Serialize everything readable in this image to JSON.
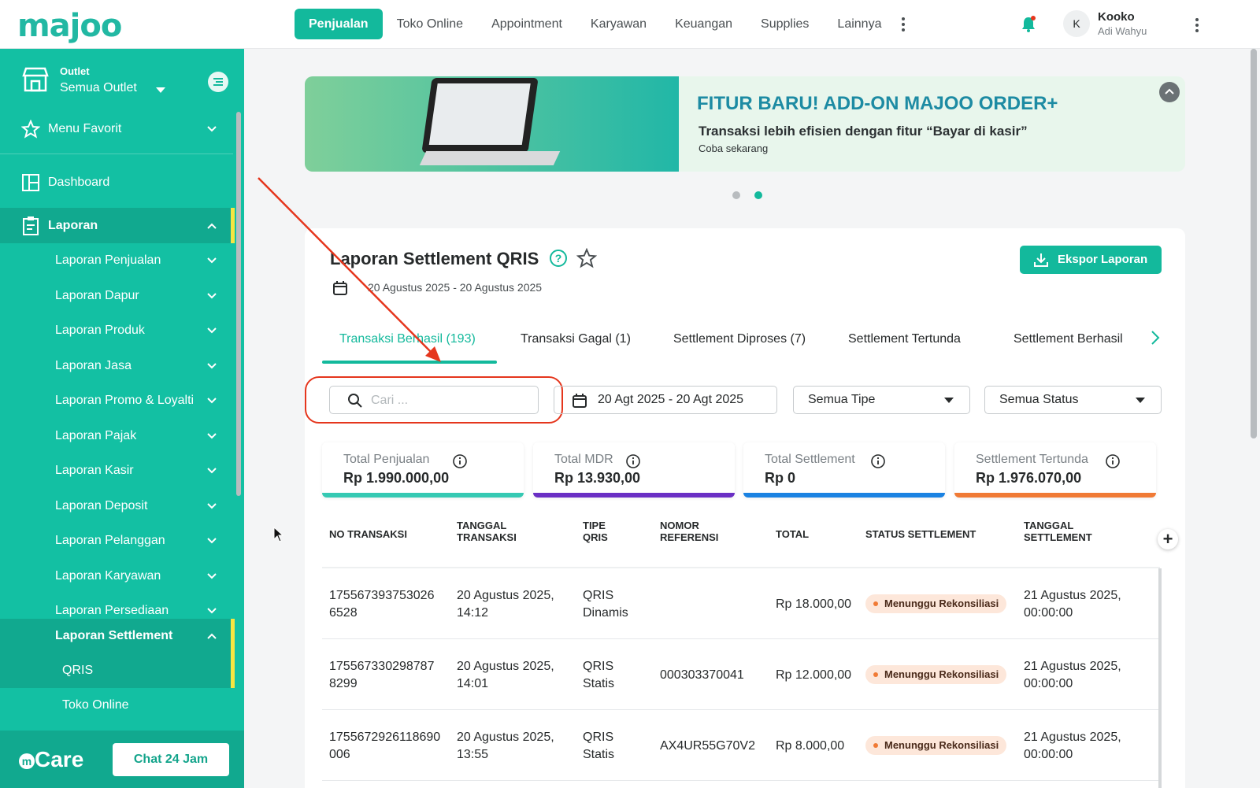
{
  "brand": {
    "logo": "majoo"
  },
  "nav": {
    "items": [
      "Penjualan",
      "Toko Online",
      "Appointment",
      "Karyawan",
      "Keuangan",
      "Supplies",
      "Lainnya"
    ],
    "active": "Penjualan"
  },
  "user": {
    "initial": "K",
    "name": "Kooko",
    "sub": "Adi Wahyu"
  },
  "sidebar": {
    "outlet_label": "Outlet",
    "outlet_value": "Semua Outlet",
    "favorite": "Menu Favorit",
    "dashboard": "Dashboard",
    "laporan": "Laporan",
    "sub_items": [
      "Laporan Penjualan",
      "Laporan Dapur",
      "Laporan Produk",
      "Laporan Jasa",
      "Laporan Promo & Loyalti",
      "Laporan Pajak",
      "Laporan Kasir",
      "Laporan Deposit",
      "Laporan Pelanggan",
      "Laporan Karyawan",
      "Laporan Persediaan"
    ],
    "settlement": "Laporan Settlement",
    "settlement_children": [
      "QRIS",
      "Toko Online"
    ],
    "care_label": "Care",
    "chat_button": "Chat 24 Jam"
  },
  "banner": {
    "title": "FITUR BARU! ADD-ON MAJOO ORDER+",
    "subtitle": "Transaksi lebih efisien dengan fitur “Bayar di kasir”",
    "cta": "Coba sekarang"
  },
  "report": {
    "title": "Laporan Settlement QRIS",
    "date_range": "20 Agustus 2025 - 20 Agustus 2025",
    "export_label": "Ekspor Laporan",
    "tabs": [
      "Transaksi Berhasil (193)",
      "Transaksi Gagal (1)",
      "Settlement Diproses (7)",
      "Settlement Tertunda",
      "Settlement Berhasil"
    ],
    "search_placeholder": "Cari ...",
    "date_filter": "20 Agt 2025 - 20 Agt 2025",
    "type_filter": "Semua Tipe",
    "status_filter": "Semua Status",
    "stats": [
      {
        "label": "Total Penjualan",
        "value": "Rp 1.990.000,00",
        "color": "#36c9b3"
      },
      {
        "label": "Total MDR",
        "value": "Rp 13.930,00",
        "color": "#6a2fc4"
      },
      {
        "label": "Total Settlement",
        "value": "Rp 0",
        "color": "#1a82e2"
      },
      {
        "label": "Settlement Tertunda",
        "value": "Rp 1.976.070,00",
        "color": "#f07a35"
      }
    ],
    "columns": [
      "NO TRANSAKSI",
      "TANGGAL TRANSAKSI",
      "TIPE QRIS",
      "NOMOR REFERENSI",
      "TOTAL",
      "STATUS SETTLEMENT",
      "TANGGAL SETTLEMENT"
    ],
    "rows": [
      {
        "no": "175567393753026 6528",
        "date": "20 Agustus 2025, 14:12",
        "type": "QRIS Dinamis",
        "ref": "",
        "total": "Rp 18.000,00",
        "status": "Menunggu Rekonsiliasi",
        "settle": "21 Agustus 2025, 00:00:00"
      },
      {
        "no": "175567330298787 8299",
        "date": "20 Agustus 2025, 14:01",
        "type": "QRIS Statis",
        "ref": "000303370041",
        "total": "Rp 12.000,00",
        "status": "Menunggu Rekonsiliasi",
        "settle": "21 Agustus 2025, 00:00:00"
      },
      {
        "no": "1755672926118690 006",
        "date": "20 Agustus 2025, 13:55",
        "type": "QRIS Statis",
        "ref": "AX4UR55G70V2",
        "total": "Rp 8.000,00",
        "status": "Menunggu Rekonsiliasi",
        "settle": "21 Agustus 2025, 00:00:00"
      }
    ]
  },
  "colors": {
    "primary": "#13b99c",
    "sidebar": "#13c0a3",
    "highlight": "#e5361d"
  }
}
